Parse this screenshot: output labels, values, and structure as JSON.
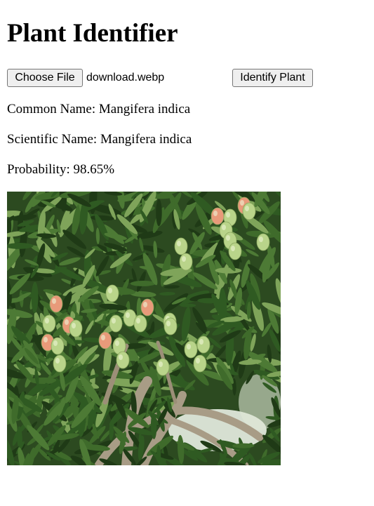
{
  "header": {
    "title": "Plant Identifier"
  },
  "form": {
    "choose_file_label": "Choose File",
    "file_name": "download.webp",
    "identify_label": "Identify Plant"
  },
  "result": {
    "common_name_label": "Common Name:",
    "common_name": "Mangifera indica",
    "scientific_name_label": "Scientific Name:",
    "scientific_name": "Mangifera indica",
    "probability_label": "Probability:",
    "probability": "98.65%"
  },
  "image": {
    "subject": "mango-tree-with-fruit",
    "colors": {
      "leaf_dark": "#1f3a16",
      "leaf_mid": "#3f6b2b",
      "leaf_light": "#7fa45a",
      "fruit_green": "#b9d48a",
      "fruit_blush": "#e89a7a",
      "branch": "#a89c86",
      "sky": "#e9efe4"
    }
  }
}
